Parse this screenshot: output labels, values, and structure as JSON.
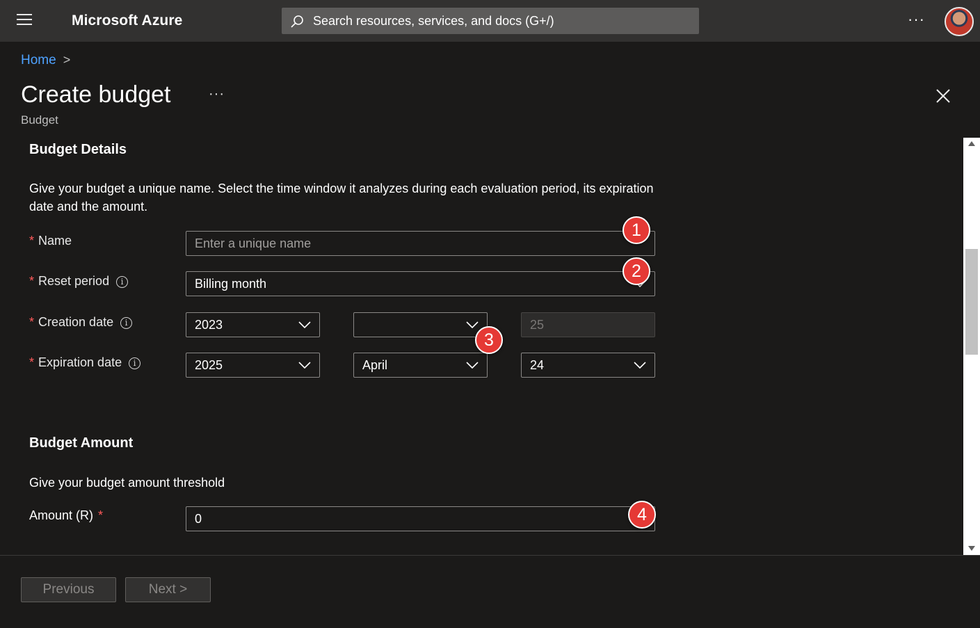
{
  "header": {
    "brand": "Microsoft Azure",
    "search_placeholder": "Search resources, services, and docs (G+/)",
    "more": "···"
  },
  "breadcrumb": {
    "home": "Home",
    "separator": ">"
  },
  "page": {
    "title": "Create budget",
    "more": "···",
    "subtitle": "Budget"
  },
  "details": {
    "title": "Budget Details",
    "description": "Give your budget a unique name. Select the time window it analyzes during each evaluation period, its expiration date and the amount.",
    "name": {
      "label": "Name",
      "placeholder": "Enter a unique name"
    },
    "reset_period": {
      "label": "Reset period",
      "value": "Billing month"
    },
    "creation_date": {
      "label": "Creation date",
      "year": "2023",
      "month": "",
      "day": "25"
    },
    "expiration_date": {
      "label": "Expiration date",
      "year": "2025",
      "month": "April",
      "day": "24"
    }
  },
  "amount": {
    "title": "Budget Amount",
    "description": "Give your budget amount threshold",
    "label": "Amount (R)",
    "value": "0"
  },
  "required_marker": "*",
  "info_glyph": "i",
  "badges": [
    "1",
    "2",
    "3",
    "4"
  ],
  "footer": {
    "previous": "Previous",
    "next": "Next >"
  },
  "colors": {
    "accent_link": "#4ea2ff",
    "required": "#ff5a5a",
    "badge": "#e53935"
  }
}
